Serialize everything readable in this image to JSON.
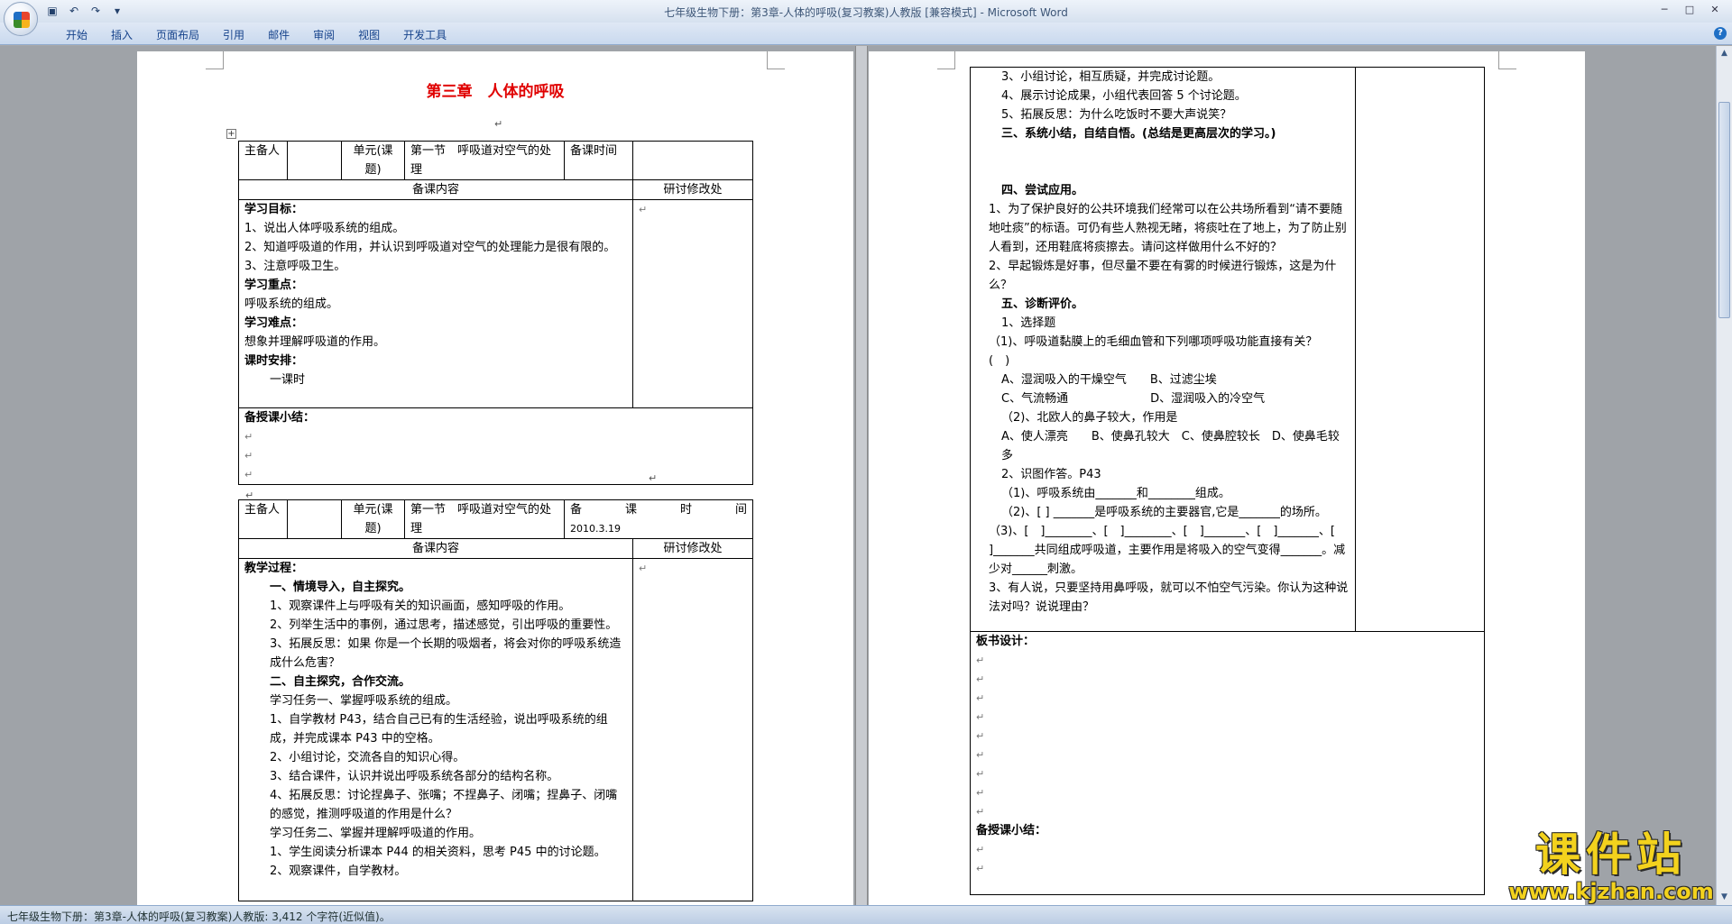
{
  "window": {
    "title": "七年级生物下册：第3章-人体的呼吸(复习教案)人教版 [兼容模式] - Microsoft Word"
  },
  "qat": {
    "save_icon": "save-icon",
    "undo_icon": "undo-icon",
    "redo_icon": "redo-icon",
    "dropdown_icon": "customize-qat-icon"
  },
  "ribbon": {
    "tabs": [
      "开始",
      "插入",
      "页面布局",
      "引用",
      "邮件",
      "审阅",
      "视图",
      "开发工具"
    ],
    "help": "?"
  },
  "page1": {
    "title": "第三章　人体的呼吸",
    "mark": "↵",
    "table1": {
      "h_author": "主备人",
      "h_unit": "单元(课题)",
      "h_unit_value": "第一节　呼吸道对空气的处理",
      "h_time": "备课时间",
      "h_content": "备课内容",
      "h_revise": "研讨修改处",
      "goal_title": "学习目标：",
      "goal_1": "1、说出人体呼吸系统的组成。",
      "goal_2": "2、知道呼吸道的作用，并认识到呼吸道对空气的处理能力是很有限的。",
      "goal_3": "3、注意呼吸卫生。",
      "key_title": "学习重点：",
      "key_1": "呼吸系统的组成。",
      "diff_title": "学习难点：",
      "diff_1": "想象并理解呼吸道的作用。",
      "hours_title": "课时安排：",
      "hours_1": "一课时",
      "summary": "备授课小结："
    },
    "table2": {
      "h_author": "主备人",
      "h_unit": "单元(课题)",
      "h_unit_value": "第一节　呼吸道对空气的处理",
      "h_time_a": "备",
      "h_time_b": "课",
      "h_time_c": "时",
      "h_time_d": "间",
      "h_date": "2010.3.19",
      "h_content": "备课内容",
      "h_revise": "研讨修改处",
      "lines": [
        {
          "t": "教学过程：",
          "s": "b"
        },
        {
          "t": "一、情境导入，自主探究。",
          "s": "b i2"
        },
        {
          "t": "1、观察课件上与呼吸有关的知识画面，感知呼吸的作用。",
          "s": "i2"
        },
        {
          "t": "2、列举生活中的事例，通过思考，描述感觉，引出呼吸的重要性。",
          "s": "i2"
        },
        {
          "t": "3、拓展反思：如果 你是一个长期的吸烟者，将会对你的呼吸系统造成什么危害？",
          "s": "i2"
        },
        {
          "t": "二、自主探究，合作交流。",
          "s": "b i2"
        },
        {
          "t": "学习任务一、掌握呼吸系统的组成。",
          "s": "i2"
        },
        {
          "t": "1、自学教材 P43，结合自己已有的生活经验，说出呼吸系统的组成，并完成课本 P43 中的空格。",
          "s": "i2"
        },
        {
          "t": "2、小组讨论，交流各自的知识心得。",
          "s": "i2"
        },
        {
          "t": "3、结合课件，认识并说出呼吸系统各部分的结构名称。",
          "s": "i2"
        },
        {
          "t": "4、拓展反思：讨论捏鼻子、张嘴；不捏鼻子、闭嘴；捏鼻子、闭嘴的感觉，推测呼吸道的作用是什么？",
          "s": "i2"
        },
        {
          "t": "学习任务二、掌握并理解呼吸道的作用。",
          "s": "i2"
        },
        {
          "t": "1、学生阅读分析课本 P44 的相关资料，思考 P45 中的讨论题。",
          "s": "i2"
        },
        {
          "t": "2、观察课件，自学教材。",
          "s": "i2"
        }
      ]
    }
  },
  "page2": {
    "lines": [
      {
        "t": "3、小组讨论，相互质疑，并完成讨论题。",
        "s": "i2"
      },
      {
        "t": "4、展示讨论成果，小组代表回答 5 个讨论题。",
        "s": "i2"
      },
      {
        "t": "5、拓展反思：为什么吃饭时不要大声说笑？",
        "s": "i2"
      },
      {
        "t": "三、系统小结，自结自悟。(总结是更高层次的学习。)",
        "s": "b i2"
      },
      {
        "t": "",
        "s": "i2"
      },
      {
        "t": "",
        "s": "i2"
      },
      {
        "t": "四、尝试应用。",
        "s": "b i2"
      },
      {
        "t": "1、为了保护良好的公共环境我们经常可以在公共场所看到“请不要随地吐痰”的标语。可仍有些人熟视无睹，将痰吐在了地上，为了防止别人看到，还用鞋底将痰擦去。请问这样做用什么不好的？",
        "s": "i1"
      },
      {
        "t": "2、早起锻炼是好事，但尽量不要在有雾的时候进行锻炼，这是为什么？",
        "s": "i1"
      },
      {
        "t": "五、诊断评价。",
        "s": "b i2"
      },
      {
        "t": "1、选择题",
        "s": "i2"
      },
      {
        "t": "（1)、呼吸道黏膜上的毛细血管和下列哪项呼吸功能直接有关？　(　)",
        "s": "i1"
      },
      {
        "t": "A、湿润吸入的干燥空气　　B、过滤尘埃",
        "s": "i2"
      },
      {
        "t": "C、气流畅通　　　　　　　D、湿润吸入的冷空气",
        "s": "i2"
      },
      {
        "t": "（2)、北欧人的鼻子较大，作用是",
        "s": "i2"
      },
      {
        "t": "A、使人漂亮　　B、使鼻孔较大　C、使鼻腔较长　D、使鼻毛较多",
        "s": "i2"
      },
      {
        "t": "2、识图作答。P43",
        "s": "i2"
      },
      {
        "t": "（1)、呼吸系统由_______和________组成。",
        "s": "i2"
      },
      {
        "t": "（2)、[ ] _______是呼吸系统的主要器官,它是_______的场所。",
        "s": "i2"
      },
      {
        "t": "（3)、[　]________、[　]________、[　]_______、[　]_______、[ ]_______共同组成呼吸道，主要作用是将吸入的空气变得_______。减少对______刺激。",
        "s": "i1"
      },
      {
        "t": "3、有人说，只要坚持用鼻呼吸，就可以不怕空气污染。你认为这种说法对吗？说说理由？",
        "s": "i1"
      }
    ],
    "board": "板书设计：",
    "summary": "备授课小结："
  },
  "statusbar": {
    "text": "七年级生物下册：第3章-人体的呼吸(复习教案)人教版: 3,412 个字符(近似值)。"
  },
  "watermark": {
    "main": "课件站",
    "url": "www.kjzhan.com"
  }
}
